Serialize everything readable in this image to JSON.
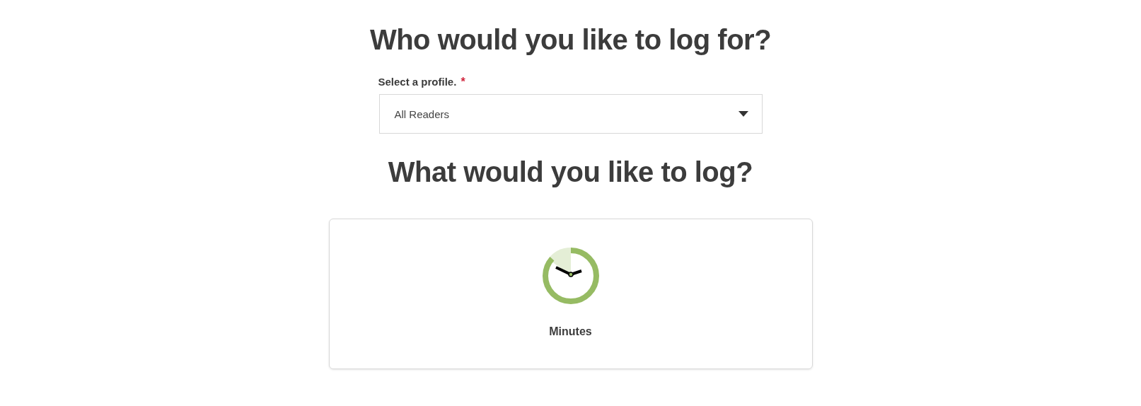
{
  "profile_heading": "Who would you like to log for?",
  "profile_field": {
    "label": "Select a profile.",
    "required_mark": "*",
    "value": "All Readers"
  },
  "log_heading": "What would you like to log?",
  "log_options": [
    {
      "kind": "clock",
      "label": "Minutes"
    }
  ]
}
